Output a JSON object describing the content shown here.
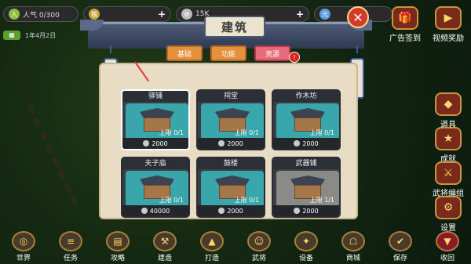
{
  "topbar": {
    "population_label": "人气 0/300",
    "gold_value": "15K"
  },
  "date": {
    "text": "1年4月2日"
  },
  "right_menu": [
    {
      "label": "广告签到",
      "icon": "gift-icon"
    },
    {
      "label": "视频奖励",
      "icon": "video-icon"
    },
    {
      "label": "道具",
      "icon": "bag-icon"
    },
    {
      "label": "成就",
      "icon": "trophy-icon"
    },
    {
      "label": "武将编组",
      "icon": "helmet-icon"
    },
    {
      "label": "设置",
      "icon": "gear-icon"
    }
  ],
  "bottom_menu": [
    {
      "label": "世界",
      "icon": "globe-icon"
    },
    {
      "label": "任务",
      "icon": "scroll-icon"
    },
    {
      "label": "攻略",
      "icon": "book-icon"
    },
    {
      "label": "建造",
      "icon": "hammer-icon"
    },
    {
      "label": "打造",
      "icon": "anvil-icon"
    },
    {
      "label": "武将",
      "icon": "general-icon"
    },
    {
      "label": "设备",
      "icon": "device-icon"
    },
    {
      "label": "商城",
      "icon": "shop-icon"
    },
    {
      "label": "保存",
      "icon": "save-icon"
    },
    {
      "label": "收回",
      "icon": "collapse-icon"
    }
  ],
  "dialog": {
    "title": "建筑",
    "tabs": [
      "基础",
      "功能",
      "资源"
    ],
    "active_tab": "资源",
    "badge": "!",
    "buildings": [
      {
        "name": "驿铺",
        "limit": "上限 0/1",
        "cost": "2000",
        "variant": "teal"
      },
      {
        "name": "祠堂",
        "limit": "上限 0/1",
        "cost": "2000",
        "variant": "teal"
      },
      {
        "name": "作木坊",
        "limit": "上限 0/1",
        "cost": "2000",
        "variant": "teal"
      },
      {
        "name": "夫子庙",
        "limit": "上限 0/1",
        "cost": "40000",
        "variant": "teal"
      },
      {
        "name": "鼓楼",
        "limit": "上限 0/1",
        "cost": "2000",
        "variant": "teal"
      },
      {
        "name": "武器铺",
        "limit": "上限 1/1",
        "cost": "2000",
        "variant": "stone"
      }
    ]
  }
}
